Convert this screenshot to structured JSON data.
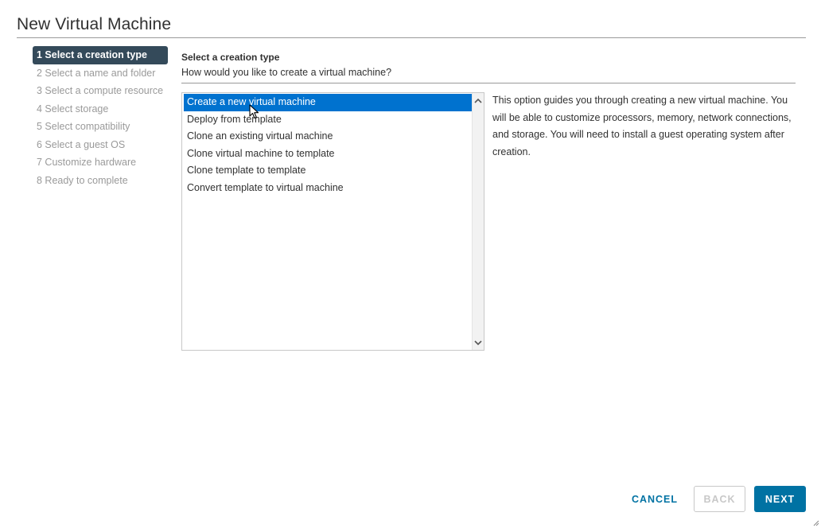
{
  "dialog": {
    "title": "New Virtual Machine"
  },
  "steps": [
    {
      "label": "1 Select a creation type",
      "active": true
    },
    {
      "label": "2 Select a name and folder",
      "active": false
    },
    {
      "label": "3 Select a compute resource",
      "active": false
    },
    {
      "label": "4 Select storage",
      "active": false
    },
    {
      "label": "5 Select compatibility",
      "active": false
    },
    {
      "label": "6 Select a guest OS",
      "active": false
    },
    {
      "label": "7 Customize hardware",
      "active": false
    },
    {
      "label": "8 Ready to complete",
      "active": false
    }
  ],
  "content": {
    "heading": "Select a creation type",
    "question": "How would you like to create a virtual machine?",
    "options": [
      {
        "label": "Create a new virtual machine",
        "selected": true
      },
      {
        "label": "Deploy from template",
        "selected": false
      },
      {
        "label": "Clone an existing virtual machine",
        "selected": false
      },
      {
        "label": "Clone virtual machine to template",
        "selected": false
      },
      {
        "label": "Clone template to template",
        "selected": false
      },
      {
        "label": "Convert template to virtual machine",
        "selected": false
      }
    ],
    "description": "This option guides you through creating a new virtual machine. You will be able to customize processors, memory, network connections, and storage. You will need to install a guest operating system after creation."
  },
  "footer": {
    "cancel_label": "CANCEL",
    "back_label": "BACK",
    "next_label": "NEXT"
  },
  "icons": {
    "scroll_up": "chevron-up-icon",
    "scroll_down": "chevron-down-icon",
    "cursor": "mouse-pointer-icon",
    "resize": "resize-grip-icon"
  },
  "colors": {
    "selection": "#0072cf",
    "active_step": "#344a5a",
    "primary_button": "#0072a3",
    "disabled": "#c8c8c8"
  }
}
